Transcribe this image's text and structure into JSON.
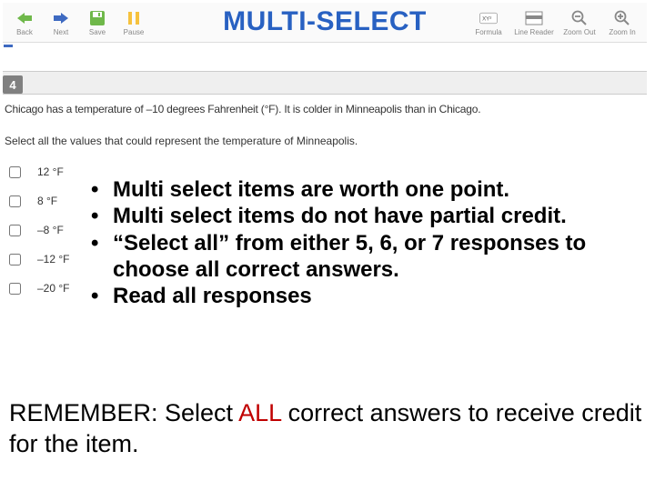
{
  "toolbar": {
    "left": {
      "back": "Back",
      "next": "Next",
      "save": "Save",
      "pause": "Pause"
    },
    "right": {
      "formula": "Formula",
      "line_reader": "Line Reader",
      "zoom_out": "Zoom Out",
      "zoom_in": "Zoom In"
    }
  },
  "title": "MULTI-SELECT",
  "question": {
    "number": "4",
    "stem1": "Chicago has a temperature of –10 degrees Fahrenheit (°F). It is colder in Minneapolis than in Chicago.",
    "stem2": "Select all the values that could represent the temperature of Minneapolis.",
    "choices": [
      "12 °F",
      "8 °F",
      "–8 °F",
      "–12 °F",
      "–20 °F"
    ]
  },
  "bullets": [
    "Multi select items are worth one point.",
    "Multi select items do not have partial credit.",
    "“Select all” from either 5, 6, or 7 responses to choose all correct answers.",
    "Read all responses"
  ],
  "remember": {
    "lead": "REMEMBER: Select ",
    "all": "ALL",
    "tail": " correct answers to receive credit for the item."
  }
}
